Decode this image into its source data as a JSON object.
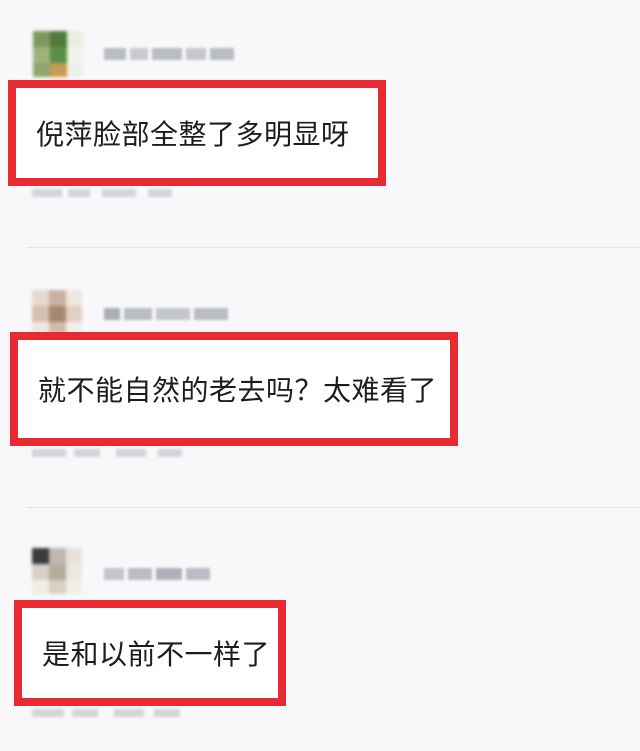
{
  "comments": [
    {
      "text": "倪萍脸部全整了多明显呀",
      "avatar_colors": [
        "#7d9a5a",
        "#4f7a3b",
        "#e9efe0",
        "#9eb37a",
        "#5b8f47",
        "#f0f2ec",
        "#8fa56c",
        "#c99a52",
        "#edf0e8"
      ]
    },
    {
      "text": "就不能自然的老去吗？太难看了",
      "avatar_colors": [
        "#e6d9cf",
        "#c9b1a0",
        "#efe6df",
        "#d7c0ae",
        "#a88772",
        "#e2cfc1",
        "#efe8e2",
        "#d2bca9",
        "#f3eee9"
      ]
    },
    {
      "text": "是和以前不一样了",
      "avatar_colors": [
        "#3a3a3a",
        "#bfb8b0",
        "#e7e1da",
        "#d8cfc6",
        "#b7ab9e",
        "#ece7e1",
        "#f1ece6",
        "#d9cfc4",
        "#f2eee9"
      ]
    }
  ]
}
